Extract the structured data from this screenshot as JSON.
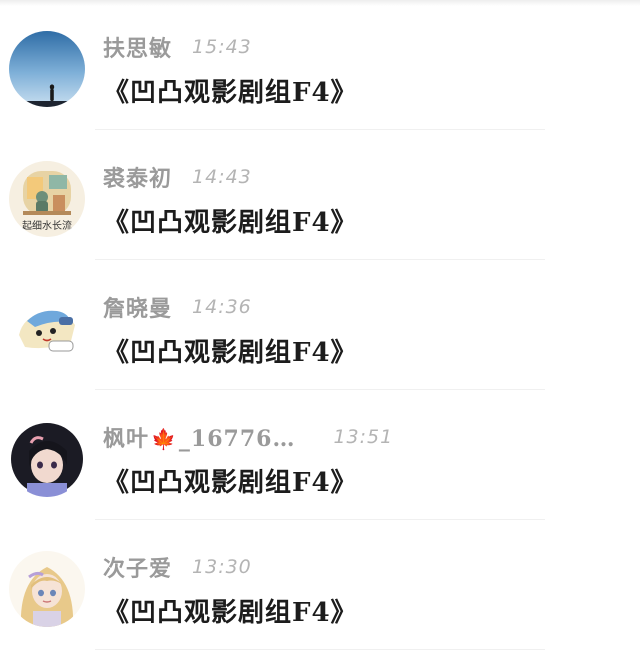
{
  "messages": [
    {
      "sender": "扶思敏",
      "time": "15:43",
      "text": "《凹凸观影剧组F4》",
      "avatar_icon": "silhouette-sky-avatar"
    },
    {
      "sender": "裘泰初",
      "time": "14:43",
      "text": "《凹凸观影剧组F4》",
      "avatar_icon": "illustrated-room-avatar",
      "avatar_caption": "起细水长流"
    },
    {
      "sender": "詹晓曼",
      "time": "14:36",
      "text": "《凹凸观影剧组F4》",
      "avatar_icon": "cartoon-character-avatar"
    },
    {
      "sender_prefix": "枫叶",
      "sender_emoji": "🍁",
      "sender_suffix": "_16776…",
      "time": "13:51",
      "text": "《凹凸观影剧组F4》",
      "avatar_icon": "anime-girl-dark-avatar"
    },
    {
      "sender": "次子爱",
      "time": "13:30",
      "text": "《凹凸观影剧组F4》",
      "avatar_icon": "anime-girl-blonde-avatar"
    }
  ],
  "colors": {
    "sender": "#9a9a9a",
    "time": "#b4b4b4",
    "message_text": "#1c1c1c",
    "divider": "#f0f0f0"
  }
}
